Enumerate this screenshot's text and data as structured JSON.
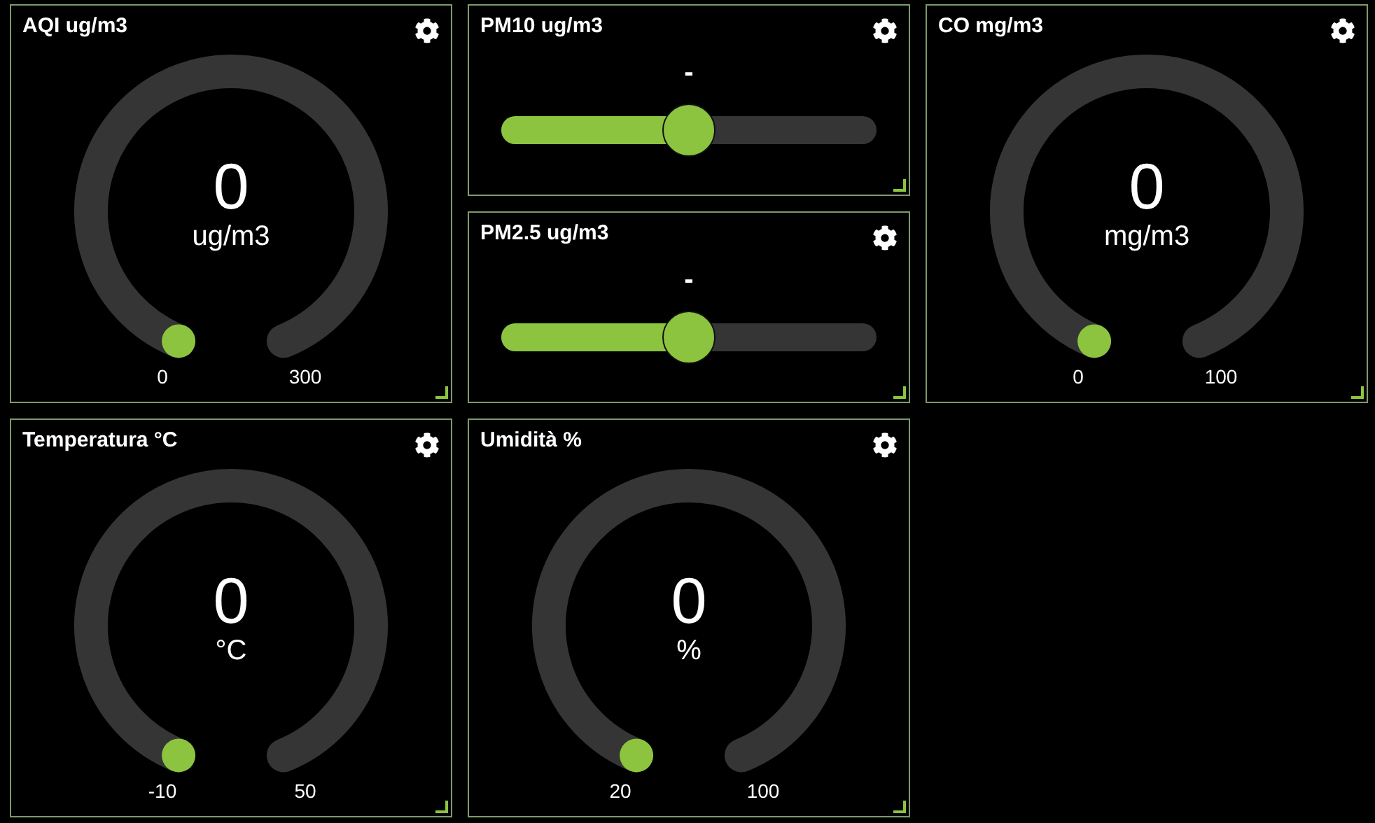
{
  "widgets": [
    {
      "kind": "gauge",
      "title": "AQI ug/m3",
      "value": "0",
      "unit": "ug/m3",
      "min": "0",
      "max": "300"
    },
    {
      "kind": "slider",
      "title": "PM10 ug/m3",
      "value": "-",
      "level": 0.5
    },
    {
      "kind": "slider",
      "title": "PM2.5 ug/m3",
      "value": "-",
      "level": 0.5
    },
    {
      "kind": "gauge",
      "title": "CO mg/m3",
      "value": "0",
      "unit": "mg/m3",
      "min": "0",
      "max": "100"
    },
    {
      "kind": "gauge",
      "title": "Temperatura °C",
      "value": "0",
      "unit": "°C",
      "min": "-10",
      "max": "50"
    },
    {
      "kind": "gauge",
      "title": "Umidità %",
      "value": "0",
      "unit": "%",
      "min": "20",
      "max": "100"
    }
  ]
}
